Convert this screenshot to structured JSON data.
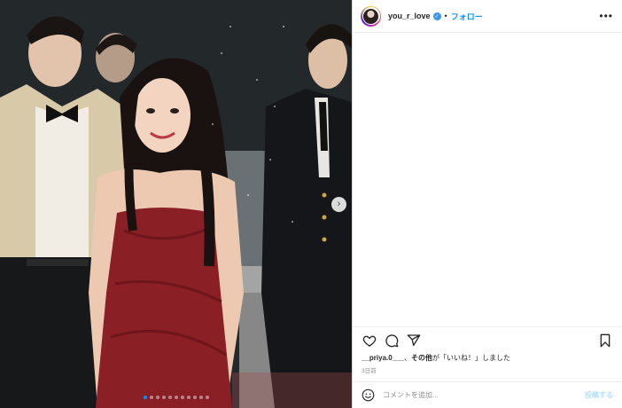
{
  "post": {
    "username": "you_r_love",
    "separator": "•",
    "follow_label": "フォロー",
    "more_icon": "more-options-icon",
    "verified_icon": "verified-badge-icon"
  },
  "media": {
    "next_icon": "chevron-right-icon",
    "carousel_count": 11,
    "carousel_active_index": 0
  },
  "actions": {
    "like_icon": "heart-icon",
    "comment_icon": "comment-icon",
    "share_icon": "paper-plane-icon",
    "save_icon": "bookmark-icon"
  },
  "likes": {
    "user": "__priya.0___",
    "text_mid": "、",
    "others": "その他",
    "text_end": "が「いいね！」しました"
  },
  "timestamp": "3日前",
  "comment": {
    "emoji_icon": "smiley-icon",
    "placeholder": "コメントを追加...",
    "post_label": "投稿する"
  },
  "colors": {
    "accent": "#0095f6",
    "post_disabled": "#b2dffc",
    "muted": "#8e8e8e"
  }
}
